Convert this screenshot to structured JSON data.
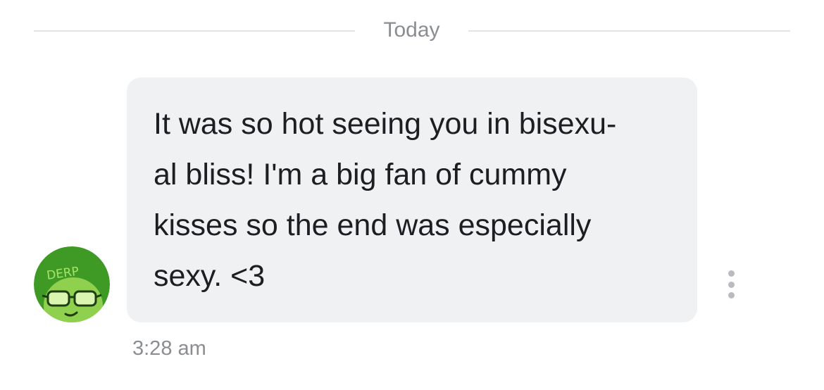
{
  "date_divider": {
    "label": "Today"
  },
  "message": {
    "text": "It was so hot seeing you in bisexu-\nal bliss! I'm a big fan of cummy\nkisses so the end was especially\nsexy. <3",
    "timestamp": "3:28 am",
    "bubble_color": "#f0f1f3"
  },
  "sender": {
    "avatar_text": "DERP",
    "avatar_color": "#3f9a25"
  },
  "actions": {
    "more_icon": "vertical-ellipsis"
  }
}
